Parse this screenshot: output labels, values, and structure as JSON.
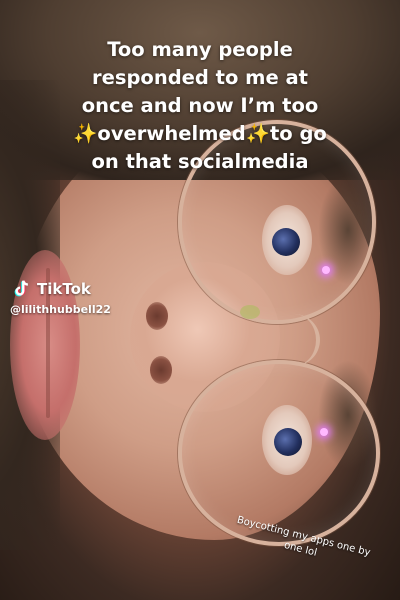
{
  "caption": {
    "line1": "Too many people",
    "line2": "responded to me at",
    "line3": "once and now I’m too",
    "line4_sparkle_left": "✨",
    "line4_word": "overwhelmed",
    "line4_sparkle_right": "✨",
    "line4_tail": "to go",
    "line5": "on that socialmedia"
  },
  "watermark": {
    "brand": "TikTok",
    "handle": "@lilithhubbell22",
    "icon": "tiktok-note-icon"
  },
  "side_note": {
    "text": "Boycotting my apps one by one lol"
  },
  "colors": {
    "caption_text": "#ffffff",
    "sparkle": "#ffd84a",
    "glasses_frame": "#d7b29d",
    "eye_glint": "#ffb9ff"
  }
}
